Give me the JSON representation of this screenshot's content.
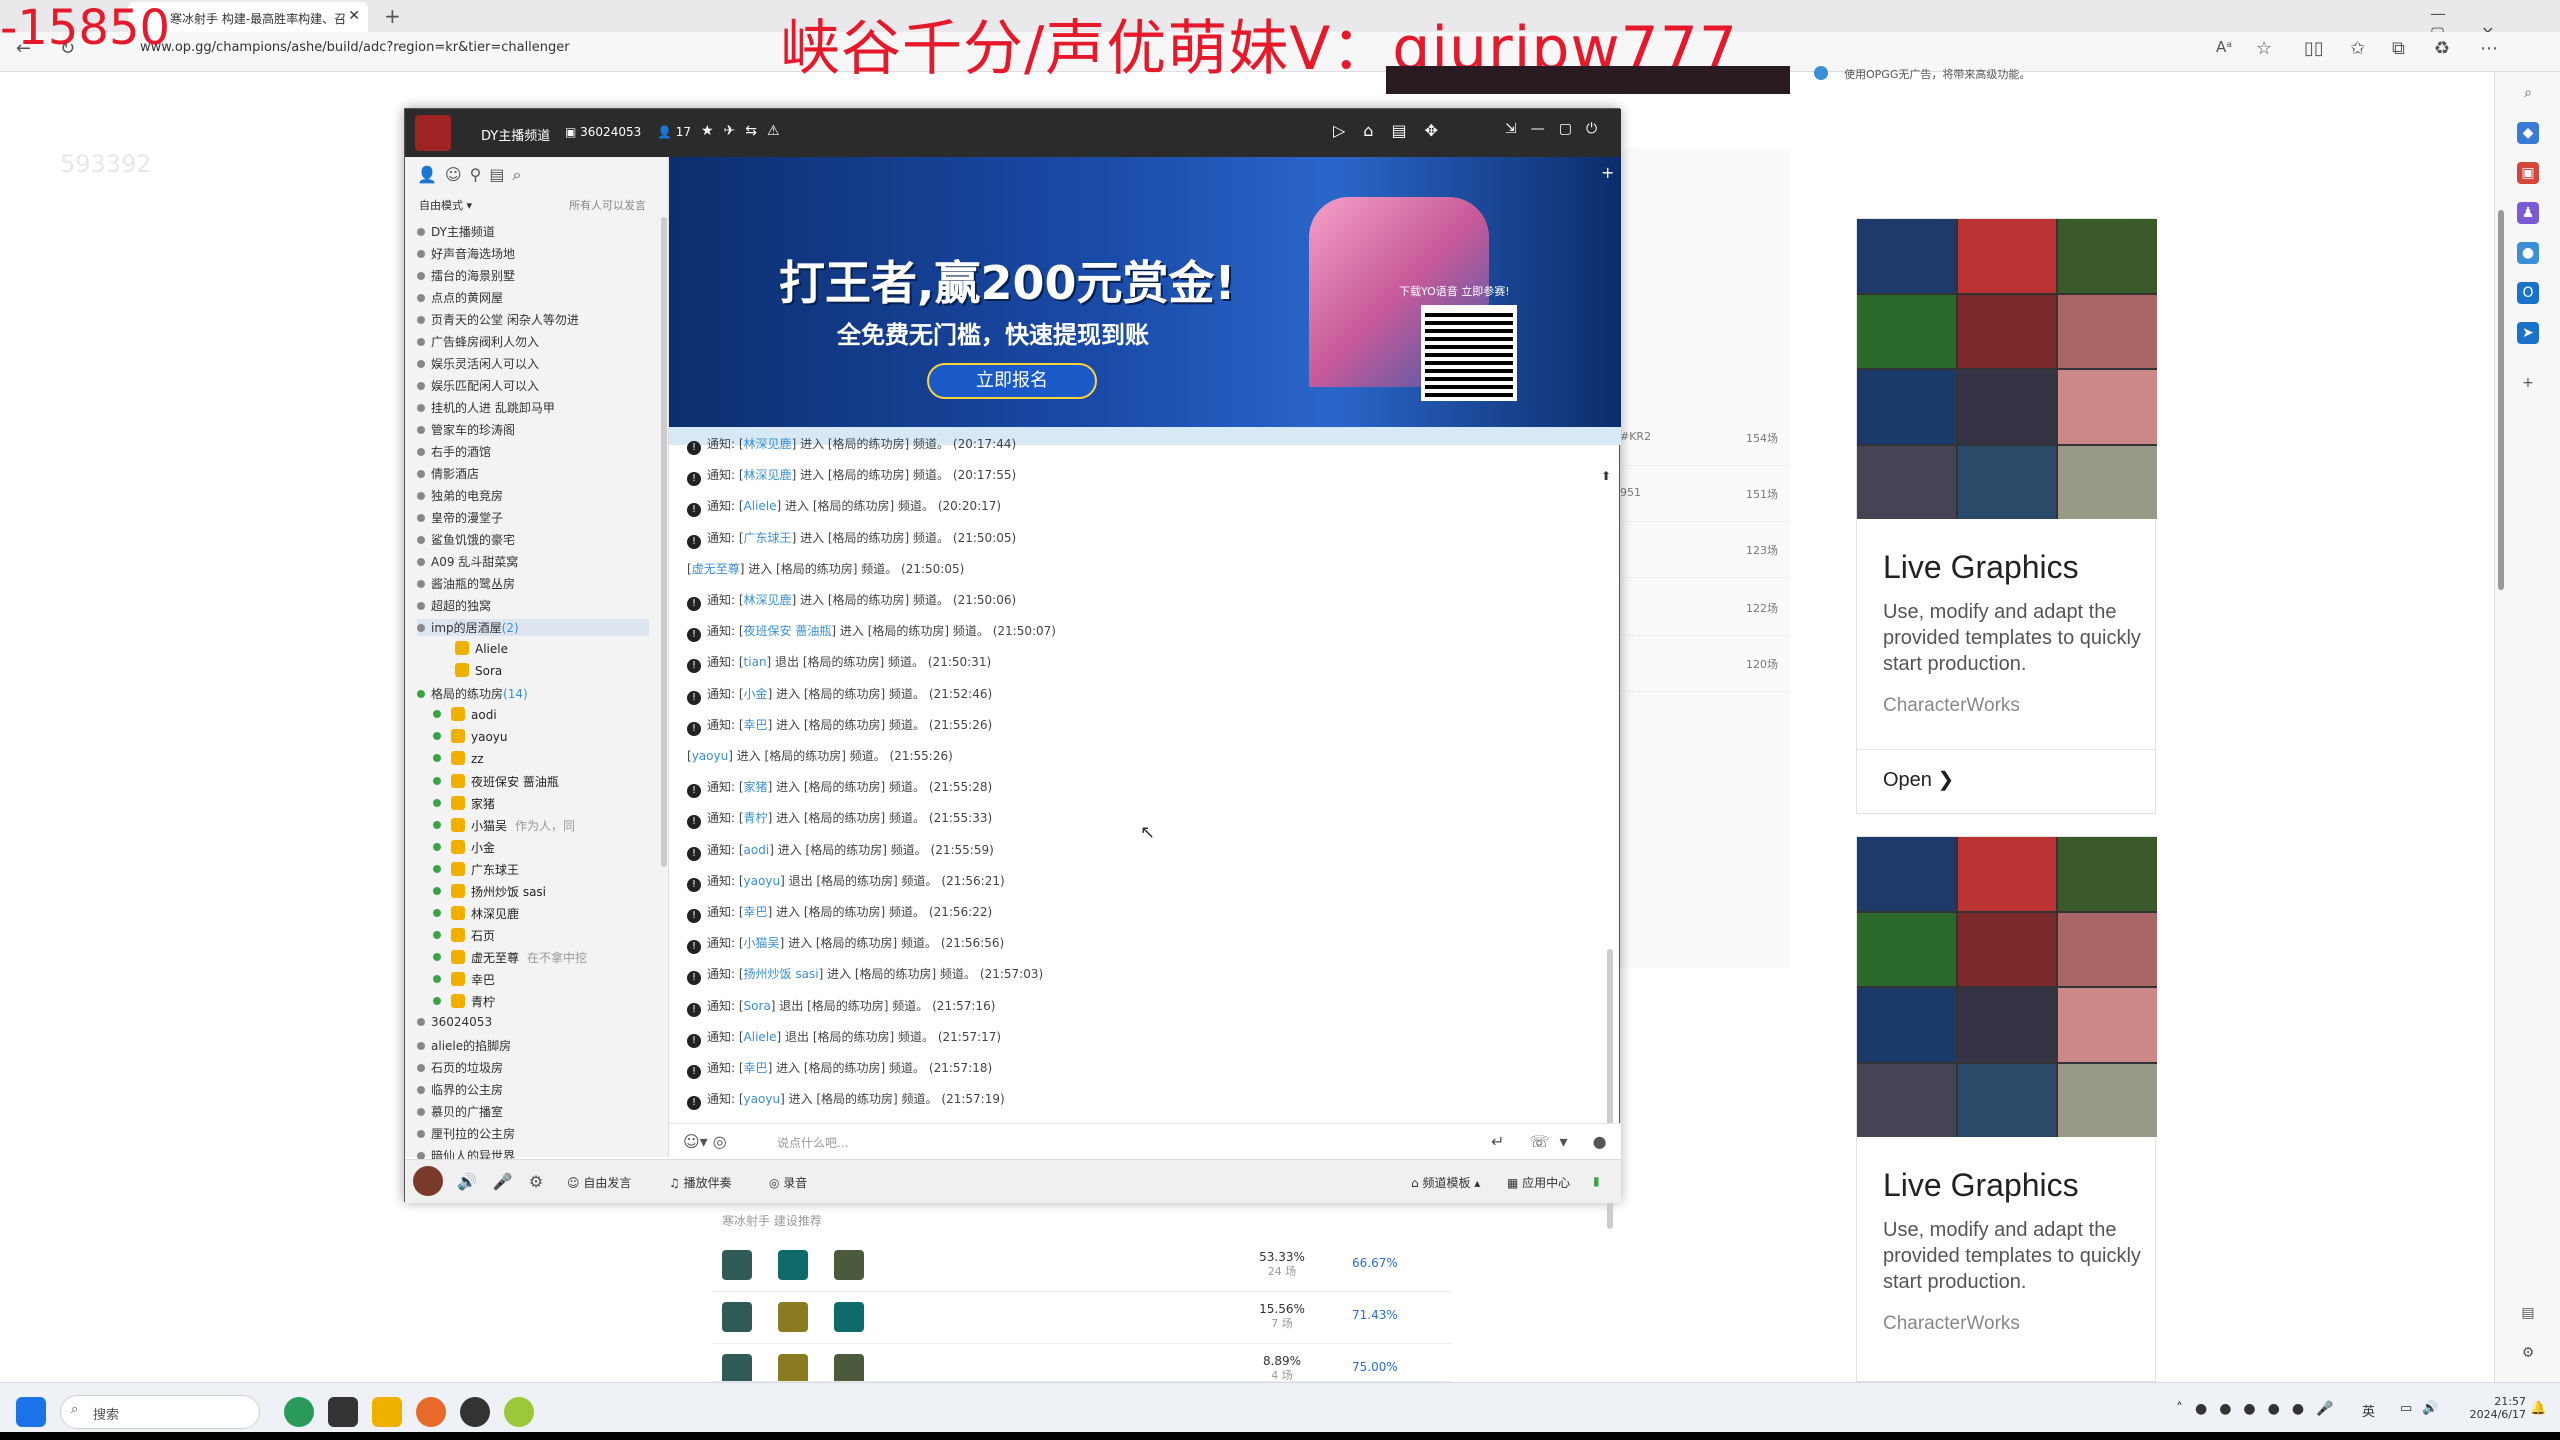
{
  "browser": {
    "tab_title": "寒冰射手 构建-最高胜率构建、召",
    "url": "www.op.gg/champions/ashe/build/adc?region=kr&tier=challenger",
    "new_tab": "+"
  },
  "stream_overlay": {
    "score": "-15850",
    "headline": "峡谷千分/声优萌妹V：qiuripw777",
    "faint_number": "593392"
  },
  "top_right_note": "使用OPGG无广告，将带来高级功能。",
  "yy": {
    "channel_name": "DY主播频道",
    "channel_id": "36024053",
    "online_count": "17",
    "mode_label": "自由模式",
    "mode_right": "所有人可以发言",
    "channels": [
      "DY主播频道",
      "好声音海选场地",
      "擂台的海景别墅",
      "点点的黄网屋",
      "页青天的公堂 闲杂人等勿进",
      "广告蜂房阀利人勿入",
      "娱乐灵活闲人可以入",
      "娱乐匹配闲人可以入",
      "挂机的人进 乱跳卸马甲",
      "管家车的珍涛阁",
      "右手的酒馆",
      "倩影酒店",
      "独弟的电竞房",
      "皇帝的漫堂子",
      "鲨鱼饥饿的豪宅",
      "A09 乱斗甜菜窝",
      "酱油瓶的鹭丛房",
      "超超的独窝"
    ],
    "channel_current": "imp的居酒屋",
    "channel_current_count": "(2)",
    "imp_users": [
      "Aliele",
      "Sora"
    ],
    "practice_room": "格局的练功房",
    "practice_count": "(14)",
    "practice_users": [
      "aodi",
      "yaoyu",
      "zz",
      "夜班保安 蔷油瓶",
      "家猪",
      "小猫吴",
      "小金",
      "广东球王",
      "扬州炒饭 sasi",
      "林深见鹿",
      "石页",
      "虚无至尊",
      "幸巴",
      "青柠"
    ],
    "practice_notes": [
      "作为人，同",
      "在不拿中挖"
    ],
    "channels_after": [
      "36024053",
      "aliele的掐脚房",
      "石页的垃圾房",
      "临界的公主房",
      "慕贝的广播室",
      "厘刊拉的公主房",
      "暗仙人的异世界"
    ],
    "banner": {
      "headline": "打王者,赢200元赏金!",
      "sub": "全免费无门槛，快速提现到账",
      "button": "立即报名",
      "qr_caption": "下载YO语音 立即参赛!"
    },
    "messages": [
      {
        "pre": "通知:",
        "name": "林深见鹿",
        "text": "进入 [格局的练功房] 频道。",
        "time": "(20:17:44)"
      },
      {
        "pre": "通知:",
        "name": "林深见鹿",
        "text": "进入 [格局的练功房] 频道。",
        "time": "(20:17:55)"
      },
      {
        "pre": "通知:",
        "name": "Aliele",
        "text": "进入 [格局的练功房] 频道。",
        "time": "(20:20:17)"
      },
      {
        "pre": "通知:",
        "name": "广东球王",
        "text": "进入 [格局的练功房] 频道。",
        "time": "(21:50:05)"
      },
      {
        "pre": "",
        "name": "虚无至尊",
        "text": "进入 [格局的练功房] 频道。",
        "time": "(21:50:05)"
      },
      {
        "pre": "通知:",
        "name": "林深见鹿",
        "text": "进入 [格局的练功房] 频道。",
        "time": "(21:50:06)"
      },
      {
        "pre": "通知:",
        "name": "夜班保安 蔷油瓶",
        "text": "进入 [格局的练功房] 频道。",
        "time": "(21:50:07)"
      },
      {
        "pre": "通知:",
        "name": "tian",
        "text": "退出 [格局的练功房] 频道。",
        "time": "(21:50:31)"
      },
      {
        "pre": "通知:",
        "name": "小金",
        "text": "进入 [格局的练功房] 频道。",
        "time": "(21:52:46)"
      },
      {
        "pre": "通知:",
        "name": "幸巴",
        "text": "进入 [格局的练功房] 频道。",
        "time": "(21:55:26)"
      },
      {
        "pre": "",
        "name": "yaoyu",
        "text": "进入 [格局的练功房] 频道。",
        "time": "(21:55:26)"
      },
      {
        "pre": "通知:",
        "name": "家猪",
        "text": "进入 [格局的练功房] 频道。",
        "time": "(21:55:28)"
      },
      {
        "pre": "通知:",
        "name": "青柠",
        "text": "进入 [格局的练功房] 频道。",
        "time": "(21:55:33)"
      },
      {
        "pre": "通知:",
        "name": "aodi",
        "text": "进入 [格局的练功房] 频道。",
        "time": "(21:55:59)"
      },
      {
        "pre": "通知:",
        "name": "yaoyu",
        "text": "退出 [格局的练功房] 频道。",
        "time": "(21:56:21)"
      },
      {
        "pre": "通知:",
        "name": "幸巴",
        "text": "进入 [格局的练功房] 频道。",
        "time": "(21:56:22)"
      },
      {
        "pre": "通知:",
        "name": "小猫吴",
        "text": "进入 [格局的练功房] 频道。",
        "time": "(21:56:56)"
      },
      {
        "pre": "通知:",
        "name": "扬州炒饭 sasi",
        "text": "进入 [格局的练功房] 频道。",
        "time": "(21:57:03)"
      },
      {
        "pre": "通知:",
        "name": "Sora",
        "text": "退出 [格局的练功房] 频道。",
        "time": "(21:57:16)"
      },
      {
        "pre": "通知:",
        "name": "Aliele",
        "text": "退出 [格局的练功房] 频道。",
        "time": "(21:57:17)"
      },
      {
        "pre": "通知:",
        "name": "幸巴",
        "text": "进入 [格局的练功房] 频道。",
        "time": "(21:57:18)"
      },
      {
        "pre": "通知:",
        "name": "yaoyu",
        "text": "进入 [格局的练功房] 频道。",
        "time": "(21:57:19)"
      }
    ],
    "input_placeholder": "说点什么吧...",
    "footer": {
      "free_speak": "自由发言",
      "music": "播放伴奏",
      "record": "录音",
      "template": "频道模板",
      "app_center": "应用中心"
    }
  },
  "page_behind": {
    "section_label": "寒冰射手 建设推荐",
    "stats": [
      {
        "prefix": "#KR2",
        "count": "154场"
      },
      {
        "prefix": "951",
        "count": "151场"
      },
      {
        "prefix": "",
        "count": "123场"
      },
      {
        "prefix": "",
        "count": "122场"
      },
      {
        "prefix": "",
        "count": "120场"
      }
    ],
    "builds": [
      {
        "pick": "53.33%",
        "games": "24 场",
        "wr": "66.67%"
      },
      {
        "pick": "15.56%",
        "games": "7 场",
        "wr": "71.43%"
      },
      {
        "pick": "8.89%",
        "games": "4 场",
        "wr": "75.00%"
      }
    ]
  },
  "ads": [
    {
      "title": "Live Graphics",
      "text": "Use, modify and adapt the provided templates to quickly start production.",
      "source": "CharacterWorks",
      "cta": "Open ❯"
    },
    {
      "title": "Live Graphics",
      "text": "Use, modify and adapt the provided templates to quickly start production.",
      "source": "CharacterWorks"
    }
  ],
  "taskbar": {
    "search": "搜索",
    "time": "21:57",
    "date": "2024/6/17",
    "lang": "英"
  }
}
